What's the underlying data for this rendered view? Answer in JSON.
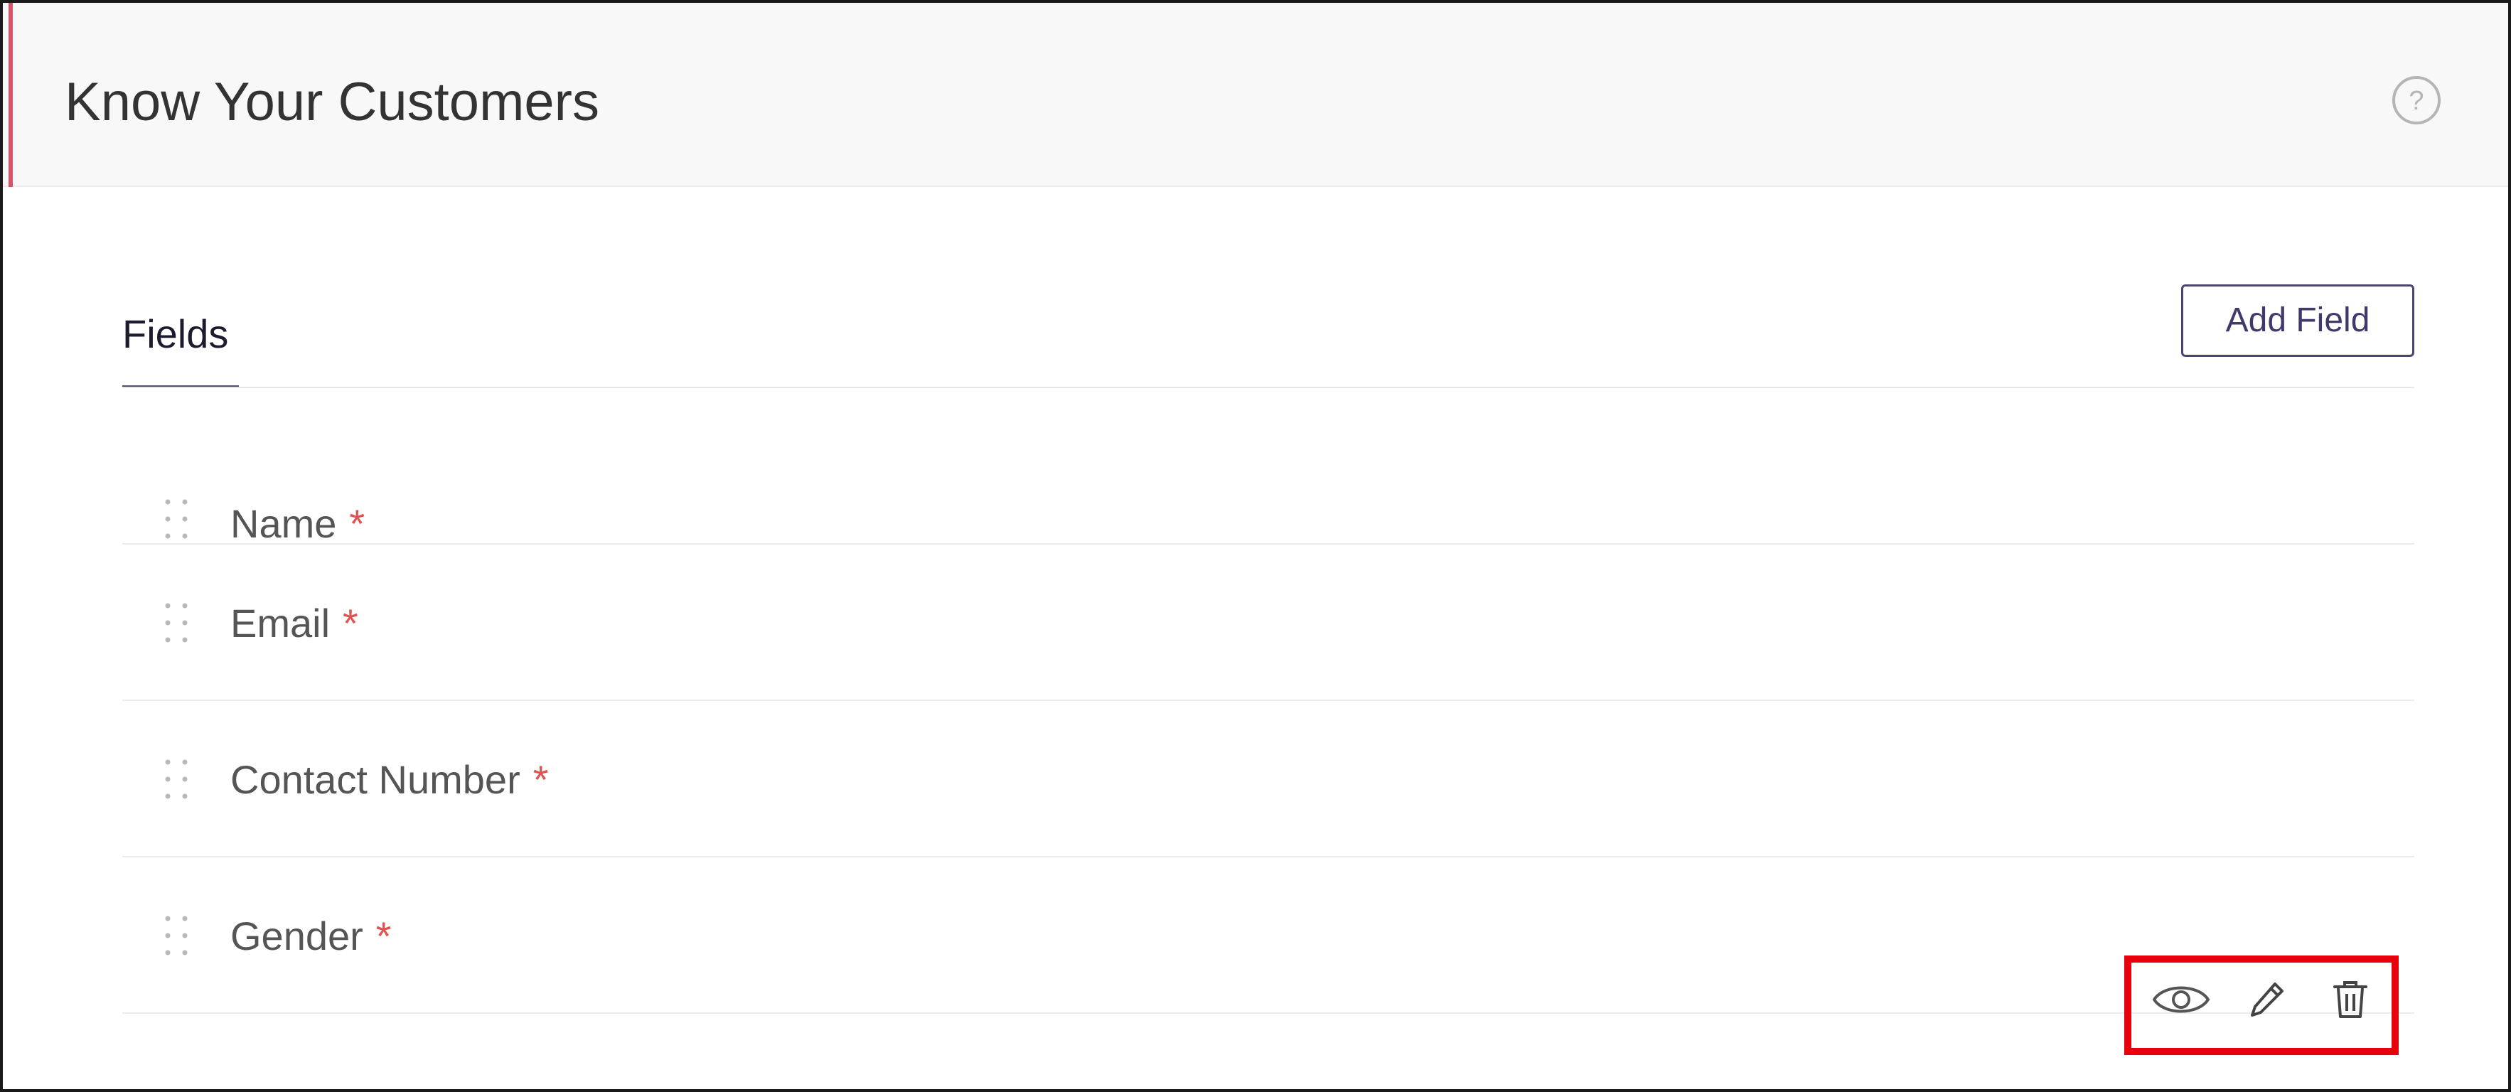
{
  "header": {
    "title": "Know Your Customers",
    "help_icon": "question-circle-icon",
    "accent_color": "#d5546a"
  },
  "tabs": [
    {
      "label": "Fields",
      "active": true
    }
  ],
  "toolbar": {
    "add_field_label": "Add Field"
  },
  "fields": [
    {
      "label": "Name",
      "required_mark": "*"
    },
    {
      "label": "Email",
      "required_mark": "*"
    },
    {
      "label": "Contact Number",
      "required_mark": "*"
    },
    {
      "label": "Gender",
      "required_mark": "*"
    }
  ],
  "row_actions": {
    "row": "Gender",
    "icons": [
      "eye-icon",
      "pencil-icon",
      "trash-icon"
    ],
    "highlight_color": "#e8000c"
  },
  "colors": {
    "primary": "#4b4574",
    "required": "#e0524f"
  }
}
